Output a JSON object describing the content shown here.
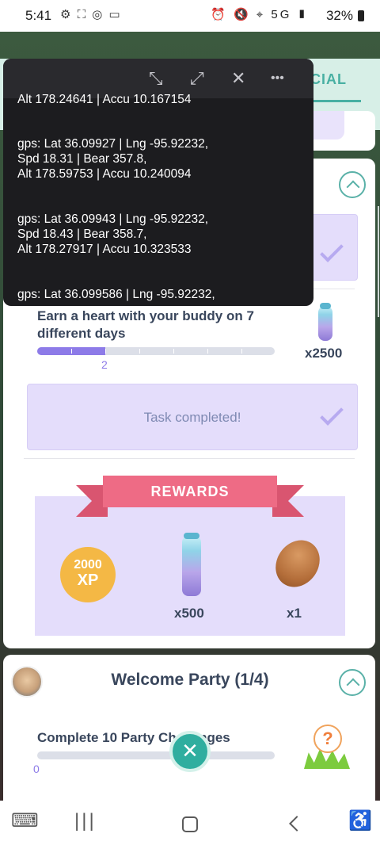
{
  "status_bar": {
    "time": "5:41",
    "left_icons": "⚙ ⛶ ◎ ▭",
    "right_icons": "⏰ 🔇 ⌖ 5G ▮",
    "battery": "32%"
  },
  "tabs": {
    "active_label": "CIAL"
  },
  "overlay": {
    "controls": {
      "minimize": "⤡",
      "expand": "⤢",
      "close": "✕",
      "more": "•••"
    },
    "lines": [
      "Alt 178.24641 | Accu 10.167154",
      "gps: Lat 36.09927 | Lng -95.92232,\nSpd 18.31 | Bear 357.8,\nAlt 178.59753 | Accu 10.240094",
      "gps: Lat 36.09943 | Lng -95.92232,\nSpd 18.43 | Bear 358.7,\nAlt 178.27917 | Accu 10.323533",
      "gps: Lat 36.099586 | Lng -95.92232,"
    ]
  },
  "research": {
    "task": {
      "text": "Earn a heart with your buddy on 7 different days",
      "progress_value": "2",
      "progress_fraction": 0.2857,
      "reward_count": "x2500"
    },
    "task_completed_label": "Task completed!",
    "rewards": {
      "title": "REWARDS",
      "xp_amount": "2000",
      "xp_unit": "XP",
      "incense_count": "x500",
      "bread_count": "x1"
    }
  },
  "welcome": {
    "title": "Welcome Party (1/4)",
    "task_text": "Complete 10 Party Challenges",
    "progress_value": "0",
    "progress_fraction": 0,
    "mystery_symbol": "?"
  },
  "fab": {
    "symbol": "✕"
  },
  "navbar": {
    "keyboard": "⌨",
    "recents": "|||",
    "accessibility": "♿"
  }
}
